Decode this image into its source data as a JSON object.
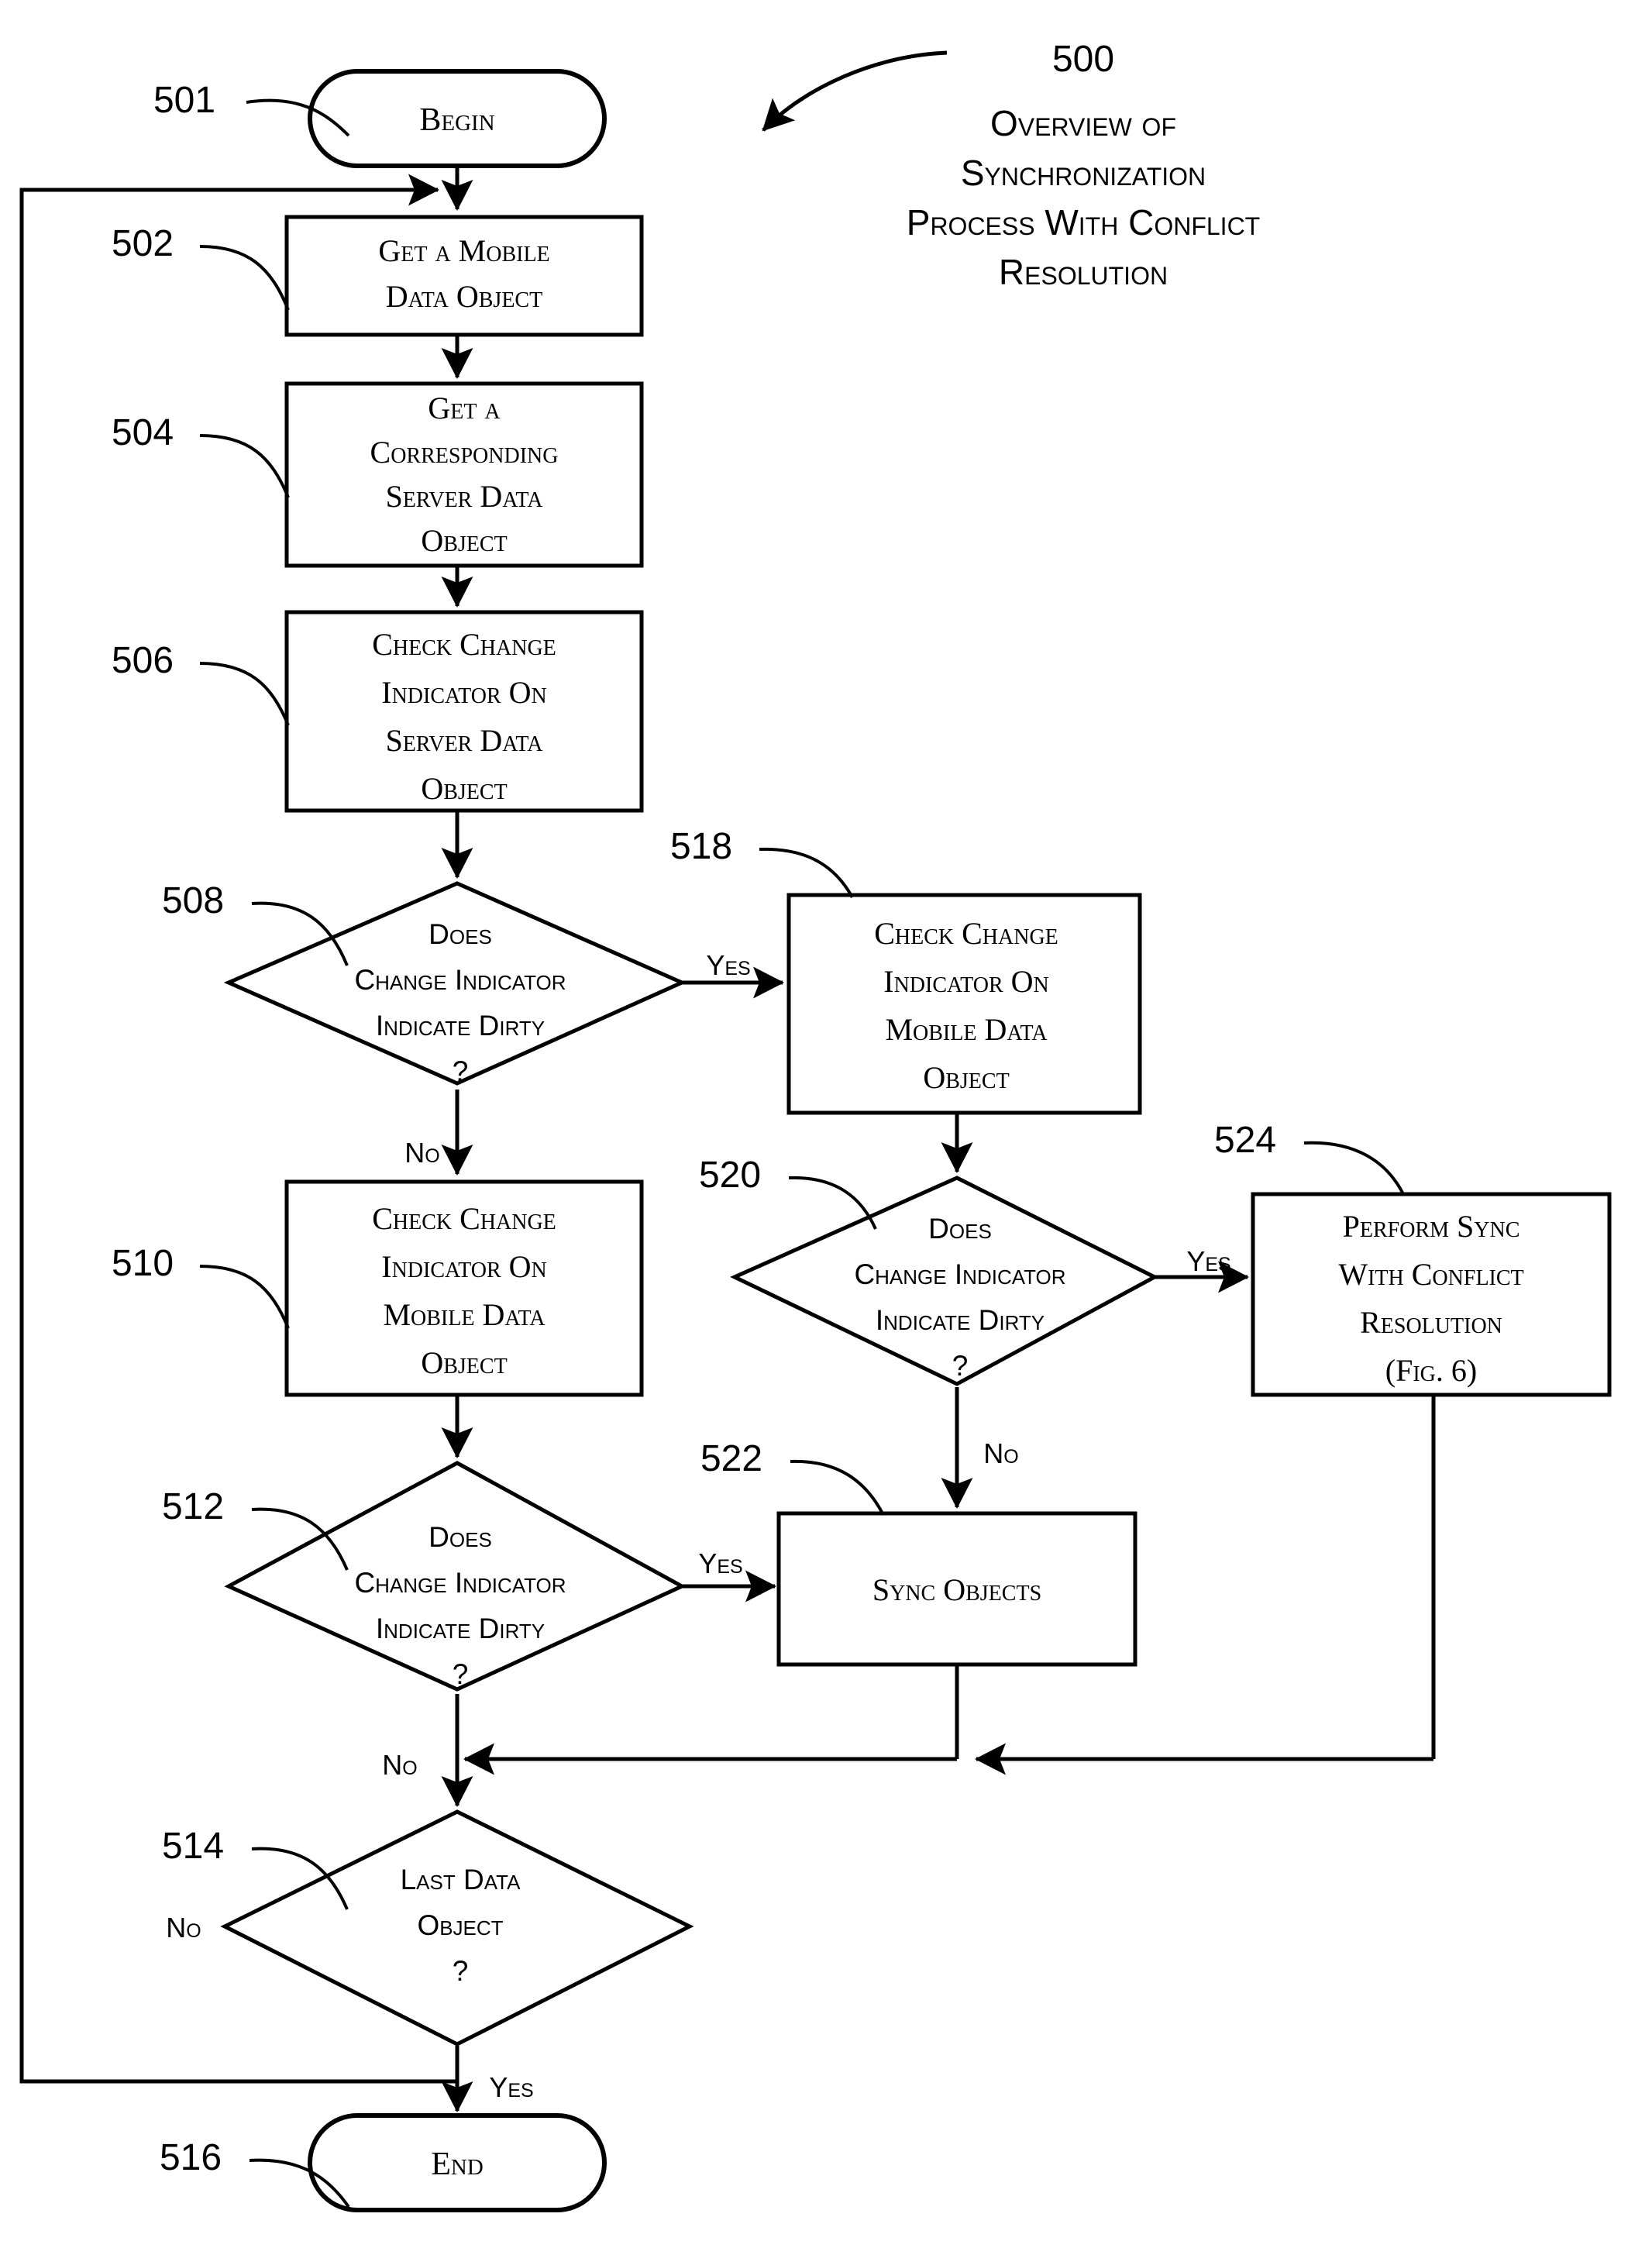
{
  "figure": {
    "title_ref": "500",
    "title_lines": [
      "Overview of",
      "Synchronization",
      "Process With Conflict",
      "Resolution"
    ]
  },
  "nodes": {
    "begin": {
      "ref": "501",
      "type": "terminator",
      "label": "Begin"
    },
    "n502": {
      "ref": "502",
      "type": "process",
      "lines": [
        "Get a Mobile",
        "Data Object"
      ]
    },
    "n504": {
      "ref": "504",
      "type": "process",
      "lines": [
        "Get a",
        "Corresponding",
        "Server Data",
        "Object"
      ]
    },
    "n506": {
      "ref": "506",
      "type": "process",
      "lines": [
        "Check Change",
        "Indicator On",
        "Server Data",
        "Object"
      ]
    },
    "n508": {
      "ref": "508",
      "type": "decision",
      "lines": [
        "Does",
        "Change Indicator",
        "Indicate Dirty",
        "?"
      ]
    },
    "n510": {
      "ref": "510",
      "type": "process",
      "lines": [
        "Check Change",
        "Indicator On",
        "Mobile Data",
        "Object"
      ]
    },
    "n512": {
      "ref": "512",
      "type": "decision",
      "lines": [
        "Does",
        "Change Indicator",
        "Indicate Dirty",
        "?"
      ]
    },
    "n514": {
      "ref": "514",
      "type": "decision",
      "lines": [
        "Last Data",
        "Object",
        "?"
      ]
    },
    "end": {
      "ref": "516",
      "type": "terminator",
      "label": "End"
    },
    "n518": {
      "ref": "518",
      "type": "process",
      "lines": [
        "Check Change",
        "Indicator On",
        "Mobile Data",
        "Object"
      ]
    },
    "n520": {
      "ref": "520",
      "type": "decision",
      "lines": [
        "Does",
        "Change Indicator",
        "Indicate Dirty",
        "?"
      ]
    },
    "n522": {
      "ref": "522",
      "type": "process",
      "lines": [
        "Sync Objects"
      ]
    },
    "n524": {
      "ref": "524",
      "type": "process",
      "lines": [
        "Perform Sync",
        "With Conflict",
        "Resolution",
        "(Fig. 6)"
      ]
    }
  },
  "edge_labels": {
    "e508_yes": "Yes",
    "e508_no": "No",
    "e512_yes": "Yes",
    "e512_no": "No",
    "e514_no": "No",
    "e514_yes": "Yes",
    "e520_yes": "Yes",
    "e520_no": "No"
  },
  "colors": {
    "stroke": "#000000",
    "fill": "#ffffff"
  }
}
